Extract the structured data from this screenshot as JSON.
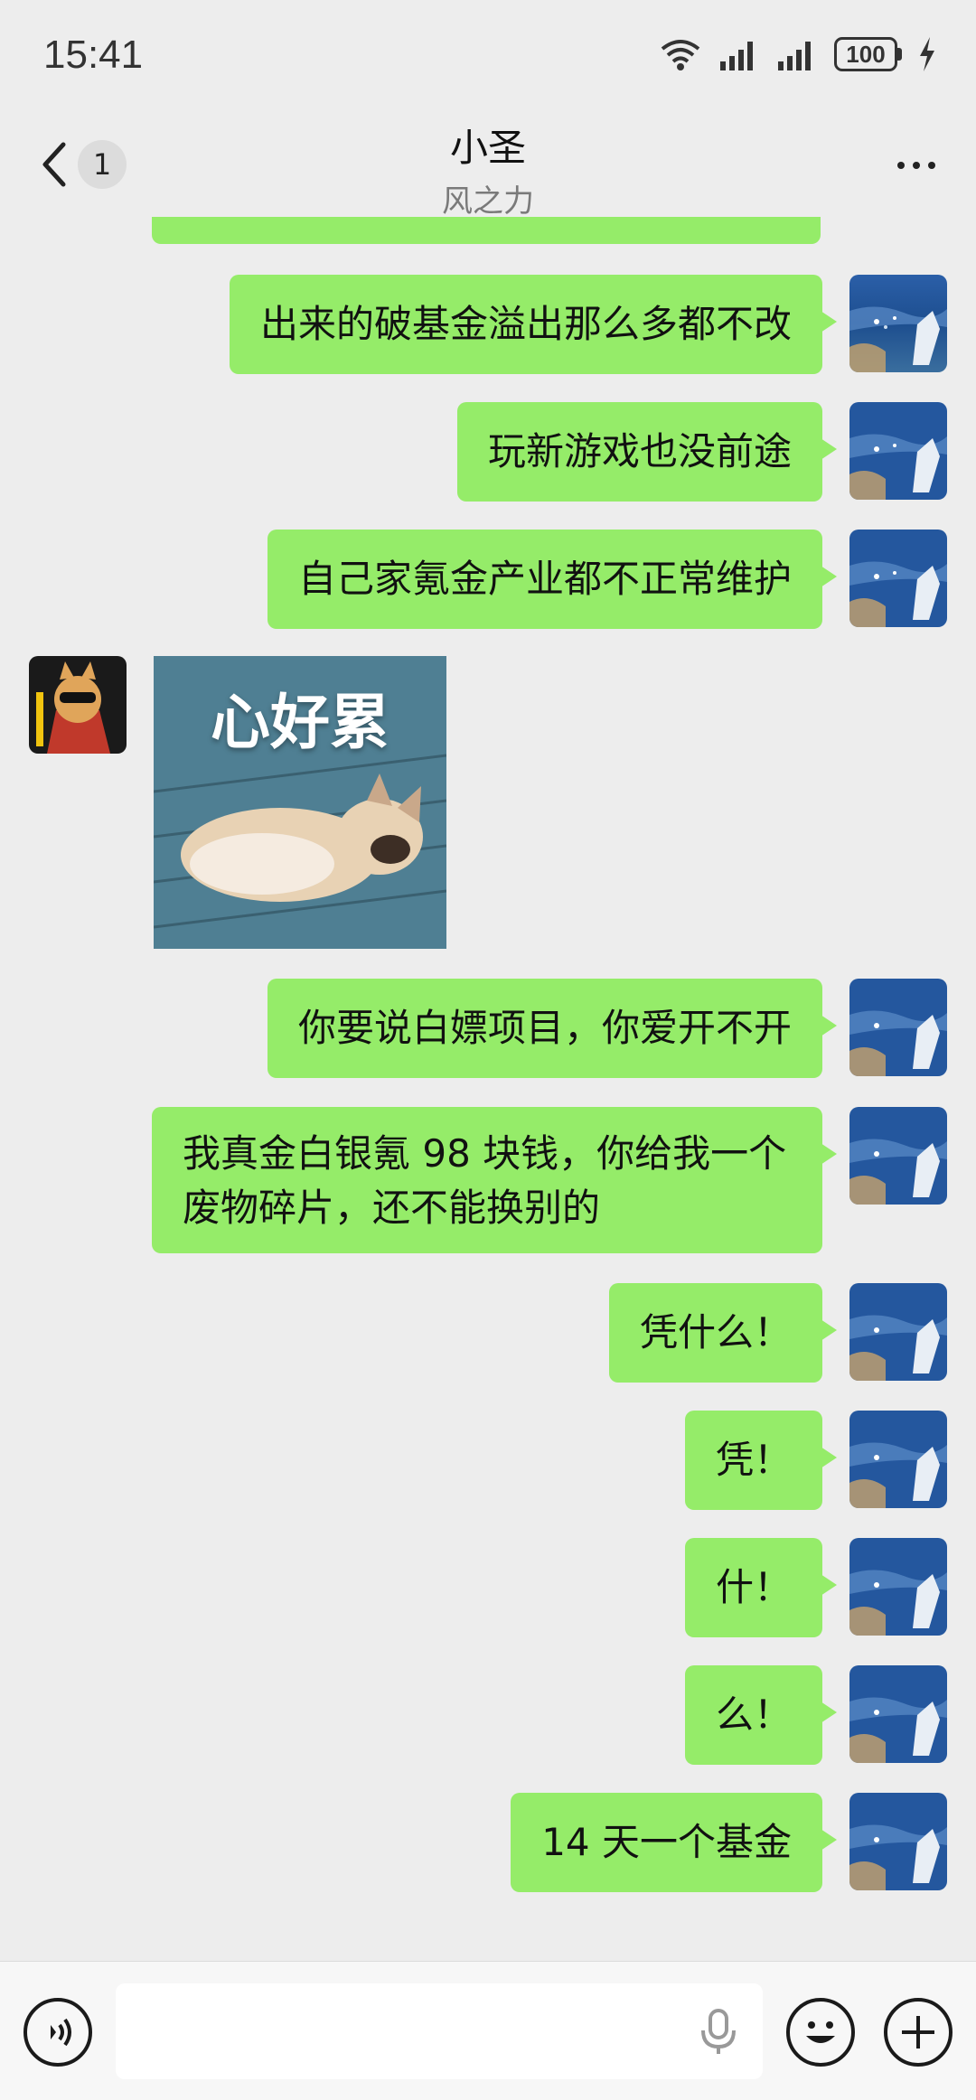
{
  "status_bar": {
    "time": "15:41",
    "battery": "100"
  },
  "header": {
    "back_badge": "1",
    "title": "小圣",
    "subtitle": "风之力"
  },
  "messages": [
    {
      "side": "self",
      "text": "出来的破基金溢出那么多都不改"
    },
    {
      "side": "self",
      "text": "玩新游戏也没前途"
    },
    {
      "side": "self",
      "text": "自己家氪金产业都不正常维护"
    },
    {
      "side": "peer",
      "type": "sticker",
      "caption": "心好累"
    },
    {
      "side": "self",
      "text": "你要说白嫖项目，你爱开不开"
    },
    {
      "side": "self",
      "text": "我真金白银氪 98 块钱，你给我一个废物碎片，还不能换别的"
    },
    {
      "side": "self",
      "text": "凭什么！"
    },
    {
      "side": "self",
      "text": "凭！"
    },
    {
      "side": "self",
      "text": "什！"
    },
    {
      "side": "self",
      "text": "么！"
    },
    {
      "side": "self",
      "text": "14 天一个基金"
    }
  ],
  "input_bar": {
    "placeholder": ""
  },
  "colors": {
    "background": "#ededed",
    "self_bubble": "#95ec69",
    "input_bar": "#f7f7f7"
  },
  "icons": [
    "back-icon",
    "more-icon",
    "voice-icon",
    "microphone-icon",
    "emoji-icon",
    "plus-icon",
    "wifi-icon",
    "signal-icon",
    "battery-icon",
    "charging-icon"
  ]
}
